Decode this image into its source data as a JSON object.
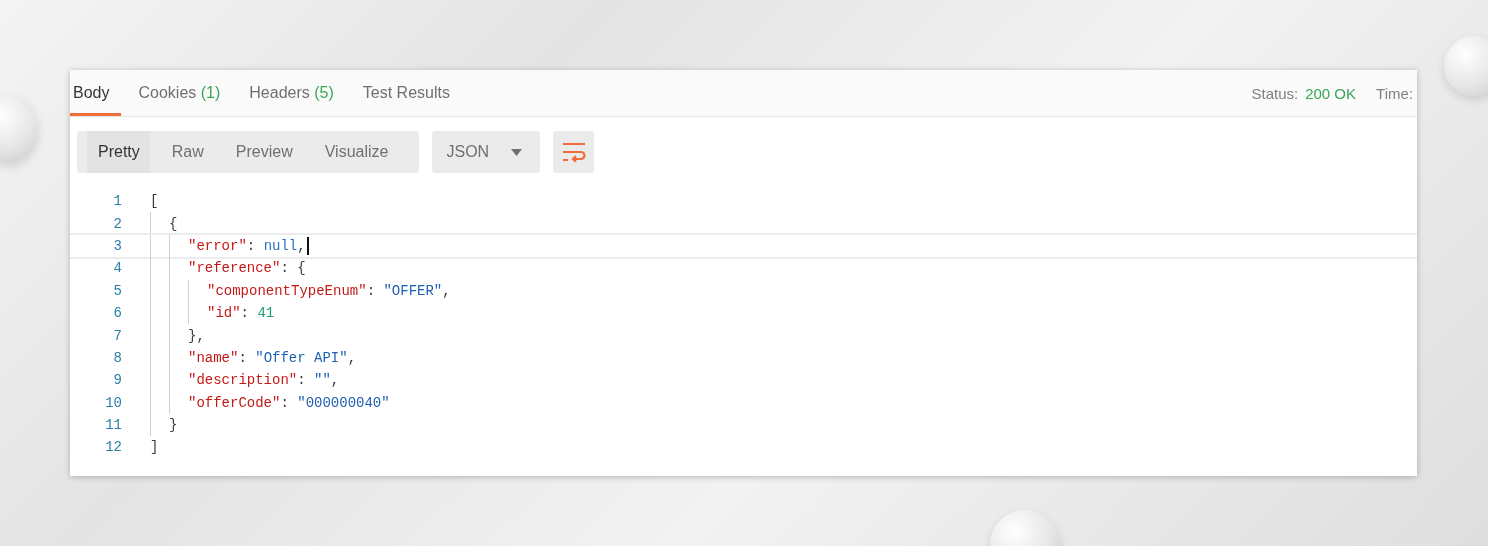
{
  "tabs": [
    {
      "label": "Body",
      "selected": true
    },
    {
      "label": "Cookies",
      "count": "(1)",
      "selected": false
    },
    {
      "label": "Headers",
      "count": "(5)",
      "selected": false
    },
    {
      "label": "Test Results",
      "selected": false
    }
  ],
  "status": {
    "label": "Status:",
    "value": "200 OK",
    "time_label": "Time:"
  },
  "view_modes": [
    {
      "label": "Pretty",
      "selected": true
    },
    {
      "label": "Raw",
      "selected": false
    },
    {
      "label": "Preview",
      "selected": false
    },
    {
      "label": "Visualize",
      "selected": false
    }
  ],
  "format": {
    "value": "JSON"
  },
  "code_lines": [
    {
      "number": "1",
      "selected": false,
      "tokens": [
        {
          "kind": "punct",
          "text": "["
        }
      ],
      "children": [
        {
          "number": "2",
          "selected": false,
          "tokens": [
            {
              "kind": "punct",
              "text": "{"
            }
          ],
          "children": [
            {
              "number": "3",
              "selected": true,
              "tokens": [
                {
                  "kind": "key",
                  "text": "\"error\""
                },
                {
                  "kind": "punct",
                  "text": ": "
                },
                {
                  "kind": "null",
                  "text": "null"
                },
                {
                  "kind": "punct",
                  "text": ","
                }
              ]
            },
            {
              "number": "4",
              "selected": false,
              "tokens": [
                {
                  "kind": "key",
                  "text": "\"reference\""
                },
                {
                  "kind": "punct",
                  "text": ": {"
                }
              ],
              "children": [
                {
                  "number": "5",
                  "selected": false,
                  "tokens": [
                    {
                      "kind": "key",
                      "text": "\"componentTypeEnum\""
                    },
                    {
                      "kind": "punct",
                      "text": ": "
                    },
                    {
                      "kind": "string",
                      "text": "\"OFFER\""
                    },
                    {
                      "kind": "punct",
                      "text": ","
                    }
                  ]
                },
                {
                  "number": "6",
                  "selected": false,
                  "tokens": [
                    {
                      "kind": "key",
                      "text": "\"id\""
                    },
                    {
                      "kind": "punct",
                      "text": ": "
                    },
                    {
                      "kind": "number",
                      "text": "41"
                    }
                  ]
                }
              ]
            },
            {
              "number": "7",
              "selected": false,
              "tokens": [
                {
                  "kind": "punct",
                  "text": "},"
                }
              ]
            },
            {
              "number": "8",
              "selected": false,
              "tokens": [
                {
                  "kind": "key",
                  "text": "\"name\""
                },
                {
                  "kind": "punct",
                  "text": ": "
                },
                {
                  "kind": "string",
                  "text": "\"Offer API\""
                },
                {
                  "kind": "punct",
                  "text": ","
                }
              ]
            },
            {
              "number": "9",
              "selected": false,
              "tokens": [
                {
                  "kind": "key",
                  "text": "\"description\""
                },
                {
                  "kind": "punct",
                  "text": ": "
                },
                {
                  "kind": "string",
                  "text": "\"\""
                },
                {
                  "kind": "punct",
                  "text": ","
                }
              ]
            },
            {
              "number": "10",
              "selected": false,
              "tokens": [
                {
                  "kind": "key",
                  "text": "\"offerCode\""
                },
                {
                  "kind": "punct",
                  "text": ": "
                },
                {
                  "kind": "string",
                  "text": "\"000000040\""
                }
              ]
            }
          ]
        },
        {
          "number": "11",
          "selected": false,
          "tokens": [
            {
              "kind": "punct",
              "text": "}"
            }
          ]
        }
      ]
    },
    {
      "number": "12",
      "selected": false,
      "tokens": [
        {
          "kind": "punct",
          "text": "]"
        }
      ]
    }
  ]
}
